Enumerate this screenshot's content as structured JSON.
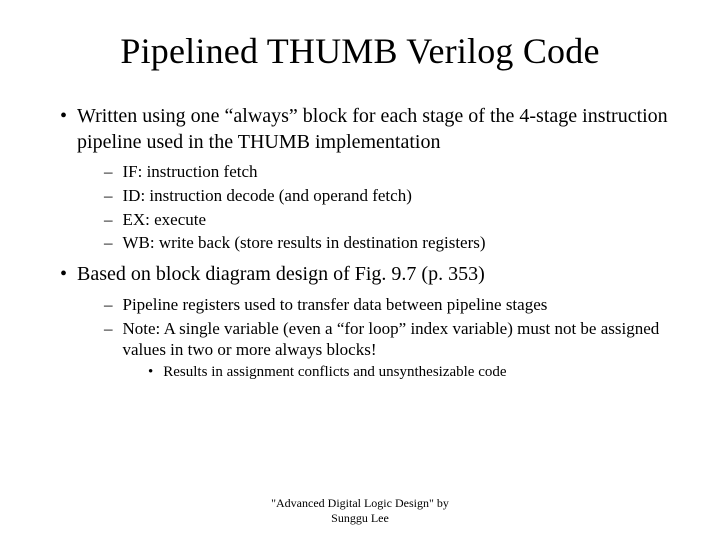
{
  "title": "Pipelined THUMB Verilog Code",
  "bullets": {
    "b1": "Written using one “always” block for each stage of the 4-stage instruction pipeline used in the THUMB implementation",
    "s1a": "IF: instruction fetch",
    "s1b": "ID: instruction decode (and operand fetch)",
    "s1c": "EX: execute",
    "s1d": "WB: write back (store results in destination registers)",
    "b2": "Based on block diagram design of Fig. 9.7 (p. 353)",
    "s2a": "Pipeline registers used to transfer data between pipeline stages",
    "s2b": "Note: A single variable (even a “for loop” index variable) must not be assigned values in two or more always blocks!",
    "s2b1": "Results in assignment conflicts and unsynthesizable code"
  },
  "markers": {
    "l1": "•",
    "l2": "–",
    "l3": "•"
  },
  "footer": {
    "line1": "\"Advanced Digital Logic Design\" by",
    "line2": "Sunggu Lee"
  }
}
